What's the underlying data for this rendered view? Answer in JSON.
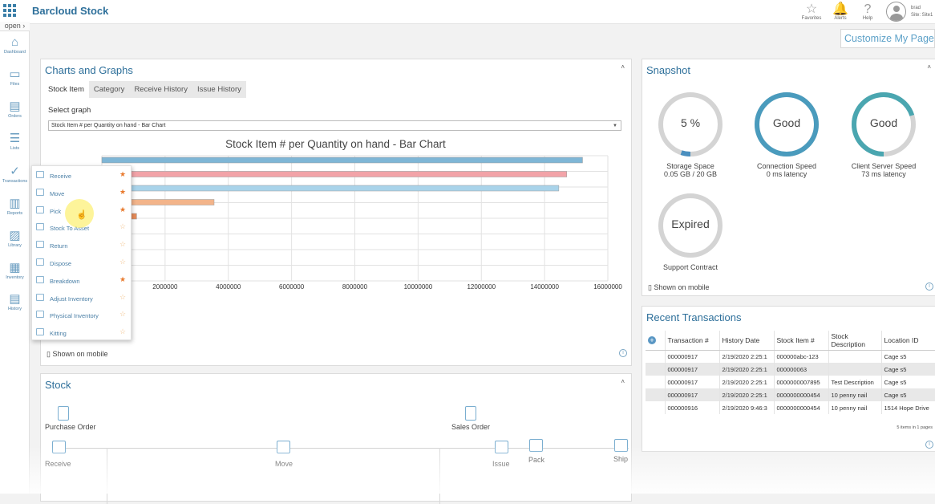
{
  "topbar": {
    "brand": "Barcloud Stock",
    "favorites": "Favorites",
    "alerts": "Alerts",
    "help": "Help",
    "user_name": "brad",
    "user_site": "Site: Site1"
  },
  "leftnav": {
    "open_label": "open",
    "items": [
      {
        "label": "Dashboard",
        "icon": "home-icon"
      },
      {
        "label": "Files",
        "icon": "folder-icon"
      },
      {
        "label": "Orders",
        "icon": "document-icon"
      },
      {
        "label": "Lists",
        "icon": "list-icon"
      },
      {
        "label": "Transactions",
        "icon": "check-circle-icon"
      },
      {
        "label": "Reports",
        "icon": "bar-chart-icon"
      },
      {
        "label": "Library",
        "icon": "image-icon"
      },
      {
        "label": "Inventory",
        "icon": "boxes-icon"
      },
      {
        "label": "History",
        "icon": "history-icon"
      }
    ]
  },
  "customize_label": "Customize My Page",
  "charts_panel": {
    "title": "Charts and Graphs",
    "caret": "˄",
    "tabs": [
      "Stock Item",
      "Category",
      "Receive History",
      "Issue History"
    ],
    "select_label": "Select graph",
    "select_value": "Stock Item # per Quantity on hand - Bar Chart",
    "shown_on_mobile": "Shown on mobile"
  },
  "chart_data": {
    "type": "bar",
    "orientation": "horizontal",
    "title": "Stock Item # per Quantity on hand - Bar Chart",
    "xlim": [
      0,
      16000000
    ],
    "x_ticks": [
      "2000000",
      "4000000",
      "6000000",
      "8000000",
      "10000000",
      "12000000",
      "14000000",
      "16000000"
    ],
    "grid": true,
    "values": [
      15200000,
      14700000,
      14450000,
      3550000,
      1100000
    ],
    "colors": [
      "#7fb6d6",
      "#f2a3a8",
      "#a9d3ea",
      "#f3b48a",
      "#e88c5a"
    ]
  },
  "transactions_menu": {
    "items": [
      {
        "label": "Receive",
        "favorite": true
      },
      {
        "label": "Move",
        "favorite": true
      },
      {
        "label": "Pick",
        "favorite": true
      },
      {
        "label": "Stock To Asset",
        "favorite": false
      },
      {
        "label": "Return",
        "favorite": false
      },
      {
        "label": "Dispose",
        "favorite": false
      },
      {
        "label": "Breakdown",
        "favorite": true
      },
      {
        "label": "Adjust Inventory",
        "favorite": false
      },
      {
        "label": "Physical Inventory",
        "favorite": false
      },
      {
        "label": "Kitting",
        "favorite": false
      }
    ]
  },
  "snapshot": {
    "title": "Snapshot",
    "caret": "˄",
    "shown_on_mobile": "Shown on mobile",
    "gauges": [
      {
        "value": "5 %",
        "label": "Storage Space",
        "sub": "0.05 GB / 20 GB",
        "fill": 0.05,
        "color": "#4a8fbf"
      },
      {
        "value": "Good",
        "label": "Connection Speed",
        "sub": "0 ms latency",
        "fill": 1.0,
        "color": "#4a9bbd"
      },
      {
        "value": "Good",
        "label": "Client Server Speed",
        "sub": "73 ms latency",
        "fill": 0.7,
        "color": "#4aa6b0"
      },
      {
        "value": "Expired",
        "label": "Support Contract",
        "sub": "",
        "fill": 0,
        "color": "#cfcfcf"
      }
    ]
  },
  "recent_transactions": {
    "title": "Recent Transactions",
    "columns": [
      "Transaction #",
      "History Date",
      "Stock Item #",
      "Stock Description",
      "Location ID"
    ],
    "rows": [
      [
        "000000917",
        "2/19/2020 2:25:1",
        "000000abc-123",
        "",
        "Cage s5"
      ],
      [
        "000000917",
        "2/19/2020 2:25:1",
        "000000063",
        "",
        "Cage s5"
      ],
      [
        "000000917",
        "2/19/2020 2:25:1",
        "0000000007895",
        "Test Description",
        "Cage s5"
      ],
      [
        "000000917",
        "2/19/2020 2:25:1",
        "0000000000454",
        "10 penny nail",
        "Cage s5"
      ],
      [
        "000000916",
        "2/19/2020 9:46:3",
        "0000000000454",
        "10 penny nail",
        "1514 Hope Drive"
      ]
    ],
    "pager": "5 items in 1 pages"
  },
  "stock_panel": {
    "title": "Stock",
    "caret": "˄",
    "nodes": {
      "purchase_order": "Purchase Order",
      "sales_order": "Sales Order",
      "receive": "Receive",
      "move": "Move",
      "issue": "Issue",
      "pack": "Pack",
      "ship": "Ship"
    }
  }
}
